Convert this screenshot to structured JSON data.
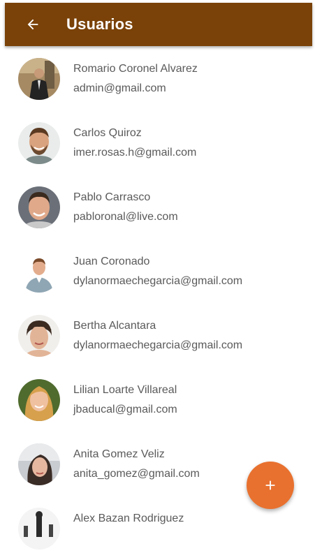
{
  "header": {
    "back_icon": "arrow-left-icon",
    "title": "Usuarios",
    "background": "#7a4208"
  },
  "users": [
    {
      "name": "Romario Coronel Alvarez",
      "email": "admin@gmail.com"
    },
    {
      "name": "Carlos Quiroz",
      "email": "imer.rosas.h@gmail.com"
    },
    {
      "name": "Pablo Carrasco",
      "email": "pabloronal@live.com"
    },
    {
      "name": "Juan Coronado",
      "email": "dylanormaechegarcia@gmail.com"
    },
    {
      "name": "Bertha Alcantara",
      "email": "dylanormaechegarcia@gmail.com"
    },
    {
      "name": "Lilian Loarte Villareal",
      "email": "jbaducal@gmail.com"
    },
    {
      "name": "Anita Gomez Veliz",
      "email": "anita_gomez@gmail.com"
    },
    {
      "name": "Alex Bazan Rodriguez",
      "email": ""
    }
  ],
  "fab": {
    "icon": "plus-icon",
    "color": "#e8712f"
  }
}
